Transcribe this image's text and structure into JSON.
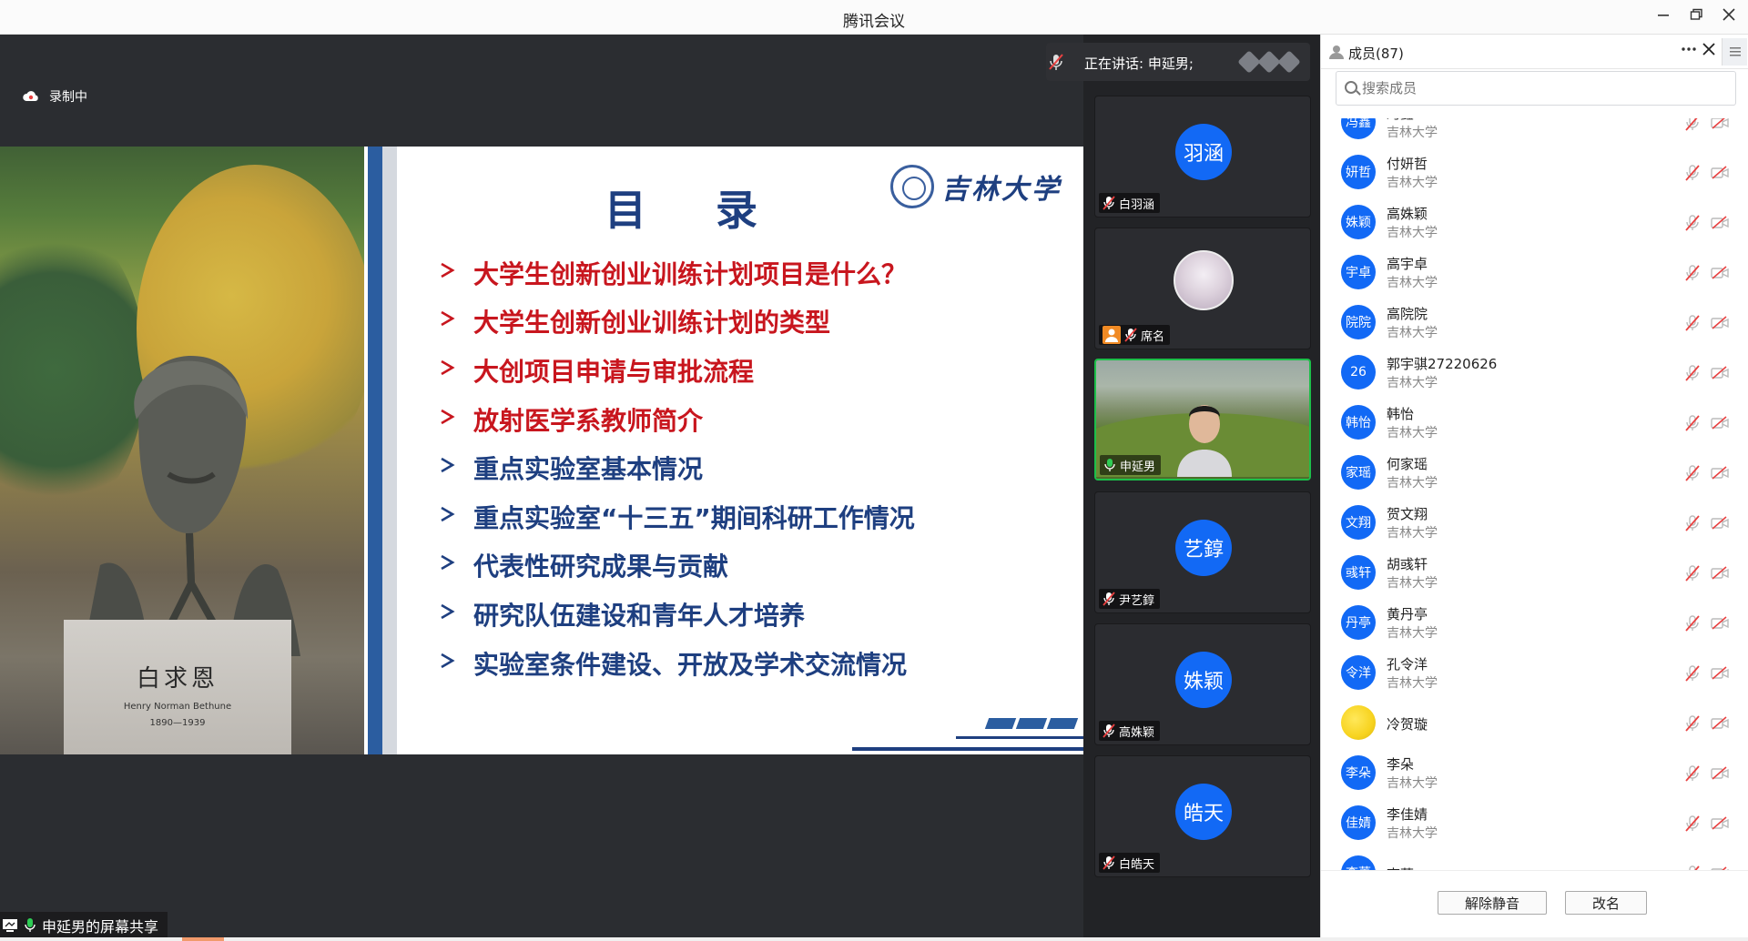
{
  "window": {
    "title": "腾讯会议"
  },
  "stage": {
    "recording_label": "录制中",
    "share_label": "申延男的屏幕共享"
  },
  "slide": {
    "title": "目 录",
    "logo_text": "吉林大学",
    "statue_name": "白求恩",
    "statue_english": "Henry Norman Bethune",
    "statue_years": "1890—1939",
    "toc": [
      {
        "text": "大学生创新创业训练计划项目是什么？",
        "color": "#c8161e"
      },
      {
        "text": "大学生创新创业训练计划的类型",
        "color": "#c8161e"
      },
      {
        "text": "大创项目申请与审批流程",
        "color": "#c8161e"
      },
      {
        "text": "放射医学系教师简介",
        "color": "#c8161e"
      },
      {
        "text": "重点实验室基本情况",
        "color": "#1e3f80"
      },
      {
        "text": "重点实验室“十三五”期间科研工作情况",
        "color": "#1e3f80"
      },
      {
        "text": "代表性研究成果与贡献",
        "color": "#1e3f80"
      },
      {
        "text": "研究队伍建设和青年人才培养",
        "color": "#1e3f80"
      },
      {
        "text": "实验室条件建设、开放及学术交流情况",
        "color": "#1e3f80"
      }
    ]
  },
  "speaking": {
    "text": "正在讲话: 申延男;"
  },
  "tiles": [
    {
      "avatar": "羽涵",
      "name": "白羽涵"
    },
    {
      "avatar": "",
      "name": "席名"
    },
    {
      "avatar": "",
      "name": "申延男"
    },
    {
      "avatar": "艺錞",
      "name": "尹艺錞"
    },
    {
      "avatar": "姝颖",
      "name": "高姝颖"
    },
    {
      "avatar": "皓天",
      "name": "白皓天"
    }
  ],
  "panel": {
    "members_label": "成员(87)",
    "search_placeholder": "搜索成员",
    "unmute_button": "解除静音",
    "rename_button": "改名"
  },
  "members": [
    {
      "avatar": "冯鑫",
      "name": "冯鑫",
      "org": "吉林大学"
    },
    {
      "avatar": "妍哲",
      "name": "付妍哲",
      "org": "吉林大学"
    },
    {
      "avatar": "姝颖",
      "name": "高姝颖",
      "org": "吉林大学"
    },
    {
      "avatar": "宇卓",
      "name": "高宇卓",
      "org": "吉林大学"
    },
    {
      "avatar": "院院",
      "name": "高院院",
      "org": "吉林大学"
    },
    {
      "avatar": "26",
      "name": "郭宇骐27220626",
      "org": "吉林大学"
    },
    {
      "avatar": "韩怡",
      "name": "韩怡",
      "org": "吉林大学"
    },
    {
      "avatar": "家瑶",
      "name": "何家瑶",
      "org": "吉林大学"
    },
    {
      "avatar": "文翔",
      "name": "贺文翔",
      "org": "吉林大学"
    },
    {
      "avatar": "彧轩",
      "name": "胡彧轩",
      "org": "吉林大学"
    },
    {
      "avatar": "丹亭",
      "name": "黄丹亭",
      "org": "吉林大学"
    },
    {
      "avatar": "令洋",
      "name": "孔令洋",
      "org": "吉林大学"
    },
    {
      "avatar": "",
      "name": "冷贺璇",
      "org": ""
    },
    {
      "avatar": "李朵",
      "name": "李朵",
      "org": "吉林大学"
    },
    {
      "avatar": "佳婧",
      "name": "李佳婧",
      "org": "吉林大学"
    },
    {
      "avatar": "李蕾",
      "name": "李蕾",
      "org": ""
    }
  ]
}
